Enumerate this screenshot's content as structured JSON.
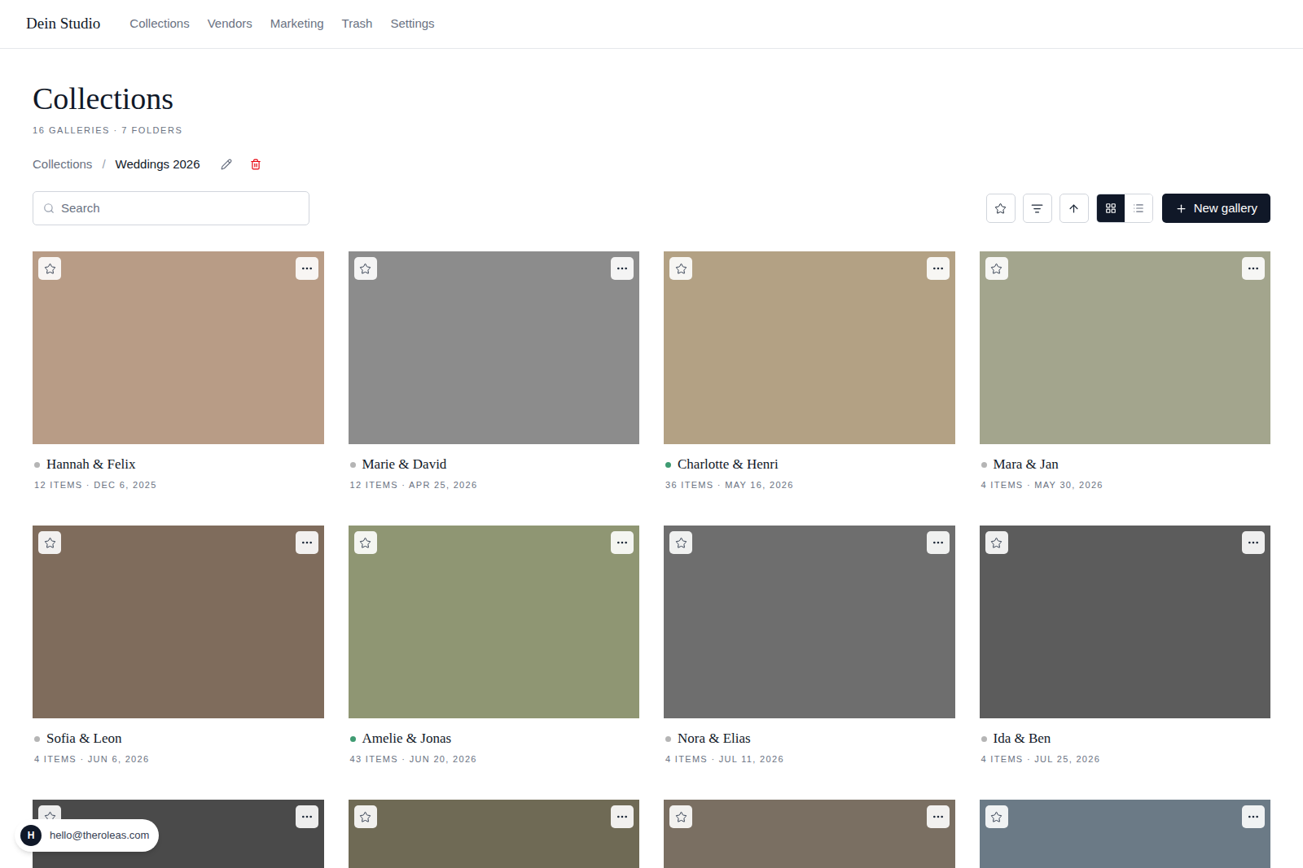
{
  "brand": "Dein Studio",
  "nav": [
    {
      "label": "Collections",
      "selected": false
    },
    {
      "label": "Vendors",
      "selected": false
    },
    {
      "label": "Marketing",
      "selected": false
    },
    {
      "label": "Trash",
      "selected": false
    },
    {
      "label": "Settings",
      "selected": false
    }
  ],
  "page": {
    "title": "Collections",
    "subtitle": "16 GALLERIES · 7 FOLDERS"
  },
  "breadcrumb": {
    "items": [
      "Collections",
      "Weddings 2026"
    ],
    "separator": "/"
  },
  "search": {
    "placeholder": "Search"
  },
  "toolbar": {
    "starred_filter": false,
    "views": [
      {
        "view": "grid",
        "selected": true
      },
      {
        "view": "list",
        "selected": false
      }
    ],
    "new_button": "New gallery"
  },
  "galleries": [
    {
      "name": "Hannah & Felix",
      "meta": "12 ITEMS · DEC 6, 2025",
      "color": "#b5b5b5",
      "starred": false
    },
    {
      "name": "Marie & David",
      "meta": "12 ITEMS · APR 25, 2026",
      "color": "#b5b5b5",
      "starred": false
    },
    {
      "name": "Charlotte & Henri",
      "meta": "36 ITEMS · MAY 16, 2026",
      "color": "#3f9b72",
      "starred": false
    },
    {
      "name": "Mara & Jan",
      "meta": "4 ITEMS · MAY 30, 2026",
      "color": "#b5b5b5",
      "starred": false
    },
    {
      "name": "Sofia & Leon",
      "meta": "4 ITEMS · JUN 6, 2026",
      "color": "#b5b5b5",
      "starred": false
    },
    {
      "name": "Amelie & Jonas",
      "meta": "43 ITEMS · JUN 20, 2026",
      "color": "#3f9b72",
      "starred": false
    },
    {
      "name": "Nora & Elias",
      "meta": "4 ITEMS · JUL 11, 2026",
      "color": "#b5b5b5",
      "starred": false
    },
    {
      "name": "Ida & Ben",
      "meta": "4 ITEMS · JUL 25, 2026",
      "color": "#b5b5b5",
      "starred": false
    }
  ],
  "partial_row": [
    {
      "starred": false
    },
    {
      "starred": false
    },
    {
      "starred": false
    },
    {
      "starred": false
    }
  ],
  "account": {
    "initial": "H",
    "email": "hello@theroleas.com"
  }
}
